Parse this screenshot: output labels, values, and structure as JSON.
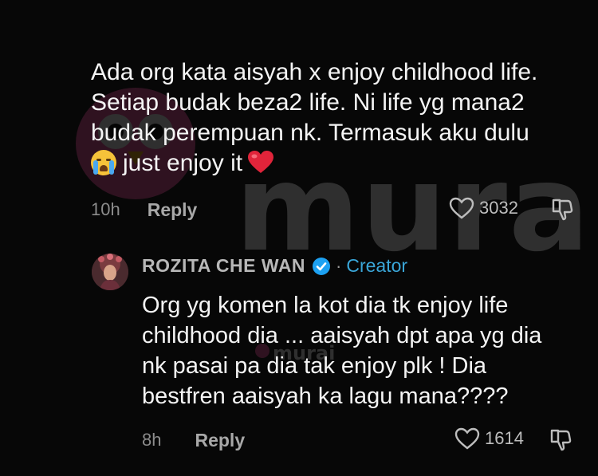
{
  "watermark": {
    "text": "murai"
  },
  "comment": {
    "lines": [
      "Ada org kata aisyah x enjoy childhood life.",
      "Setiap budak beza2 life. Ni life yg mana2",
      "budak perempuan nk. Termasuk aku dulu",
      "just enjoy it"
    ],
    "time": "10h",
    "reply_label": "Reply",
    "like_count": "3032",
    "emoji_cry": "loudly-crying-face",
    "emoji_heart": "red-heart"
  },
  "reply": {
    "author": "ROZITA CHE WAN",
    "badge": "Creator",
    "separator": "·",
    "lines": [
      "Org yg komen la kot dia tk enjoy life",
      "childhood dia ... aaisyah dpt apa yg dia",
      "nk pasai pa dia tak enjoy plk ! Dia",
      "bestfren aaisyah ka lagu mana????"
    ],
    "time": "8h",
    "reply_label": "Reply",
    "like_count": "1614"
  },
  "colors": {
    "background": "#070707",
    "creator_accent": "#3aa6d8",
    "verified": "#1da1f2",
    "heart": "#e0243a"
  }
}
